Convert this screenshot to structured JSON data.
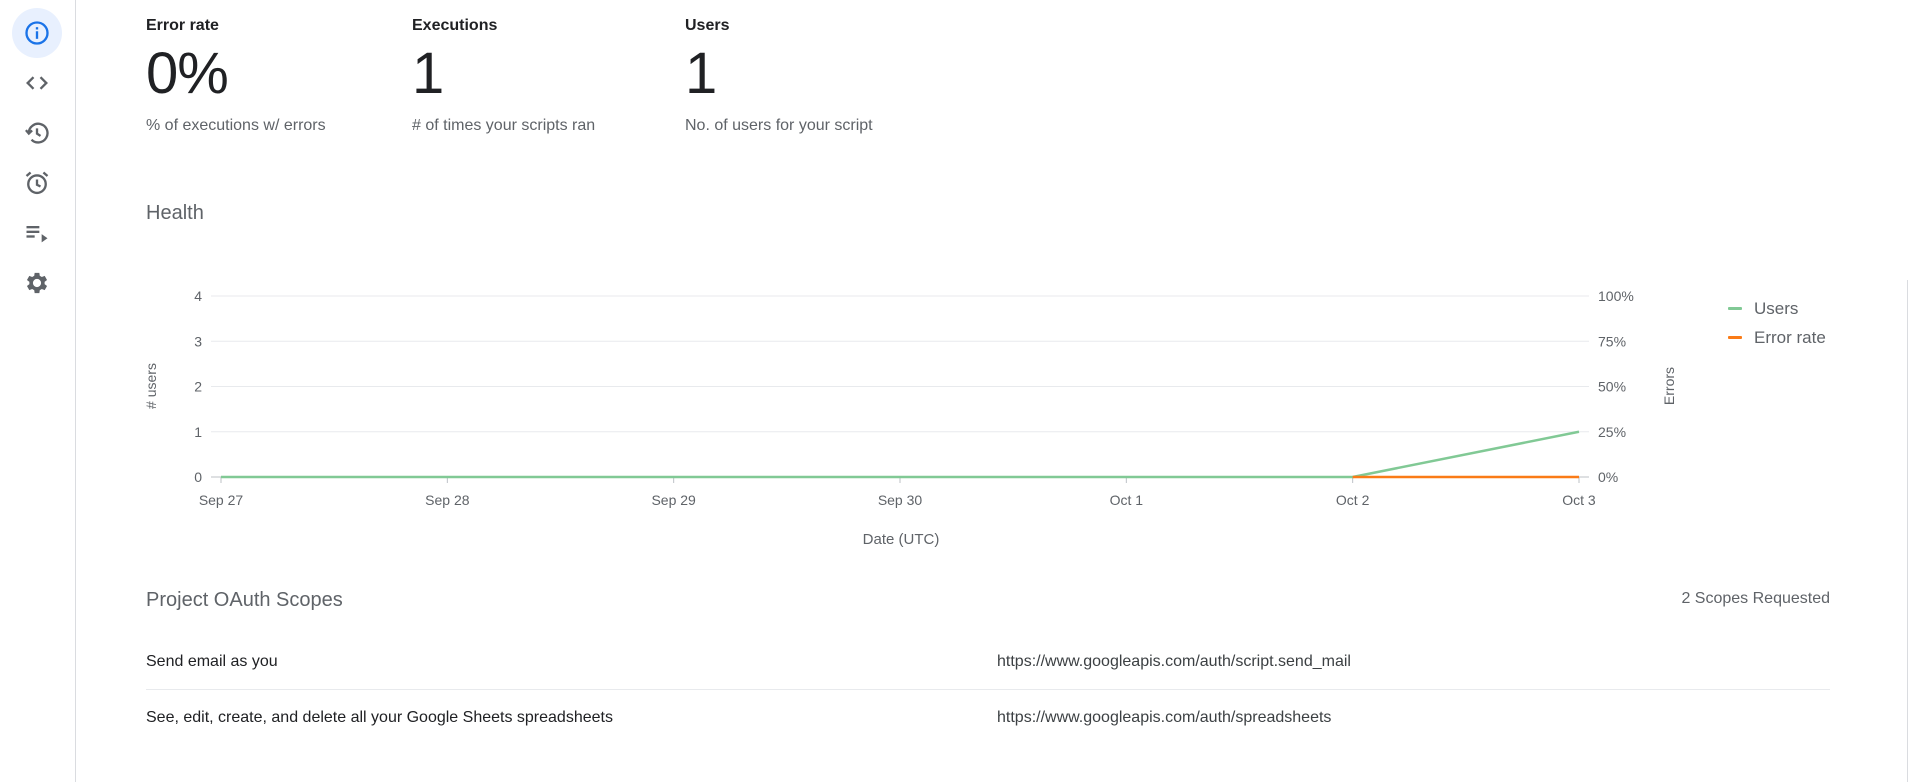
{
  "sidebar": {
    "items": [
      {
        "name": "overview",
        "icon": "info-icon",
        "active": true
      },
      {
        "name": "editor",
        "icon": "code-icon",
        "active": false
      },
      {
        "name": "versions",
        "icon": "history-icon",
        "active": false
      },
      {
        "name": "triggers",
        "icon": "alarm-icon",
        "active": false
      },
      {
        "name": "executions",
        "icon": "playlist-play-icon",
        "active": false
      },
      {
        "name": "settings",
        "icon": "gear-icon",
        "active": false
      }
    ]
  },
  "metrics": [
    {
      "label": "Error rate",
      "value": "0%",
      "description": "% of executions w/ errors"
    },
    {
      "label": "Executions",
      "value": "1",
      "description": "# of times your scripts ran"
    },
    {
      "label": "Users",
      "value": "1",
      "description": "No. of users for your script"
    }
  ],
  "health": {
    "title": "Health"
  },
  "chart_data": {
    "type": "line",
    "categories": [
      "Sep 27",
      "Sep 28",
      "Sep 29",
      "Sep 30",
      "Oct 1",
      "Oct 2",
      "Oct 3"
    ],
    "series": [
      {
        "name": "Users",
        "axis": "left",
        "color": "#81c995",
        "values": [
          0,
          0,
          0,
          0,
          0,
          0,
          1
        ]
      },
      {
        "name": "Error rate",
        "axis": "right",
        "color": "#fa7b17",
        "values": [
          null,
          null,
          null,
          null,
          null,
          0,
          0
        ]
      }
    ],
    "xlabel": "Date (UTC)",
    "ylabel": "# users",
    "ylabel_right": "Errors",
    "ylim": [
      0,
      4
    ],
    "ylim_right": [
      0,
      100
    ],
    "yticks": [
      "0",
      "1",
      "2",
      "3",
      "4"
    ],
    "yticks_right": [
      "0%",
      "25%",
      "50%",
      "75%",
      "100%"
    ],
    "grid": true,
    "legend": "right"
  },
  "scopes": {
    "title": "Project OAuth Scopes",
    "count_label": "2 Scopes Requested",
    "items": [
      {
        "description": "Send email as you",
        "url": "https://www.googleapis.com/auth/script.send_mail"
      },
      {
        "description": "See, edit, create, and delete all your Google Sheets spreadsheets",
        "url": "https://www.googleapis.com/auth/spreadsheets"
      }
    ]
  }
}
